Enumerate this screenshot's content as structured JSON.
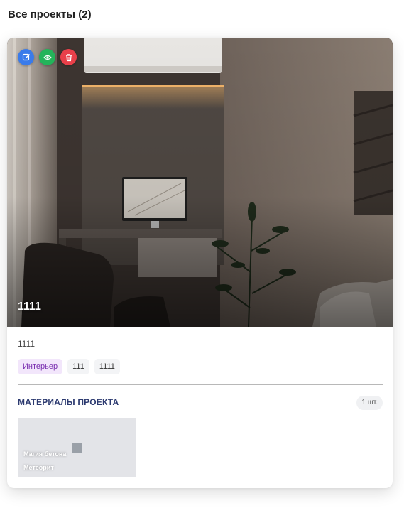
{
  "header": {
    "title": "Все проекты (2)"
  },
  "project": {
    "cover_title": "1111",
    "description": "1111",
    "actions": [
      {
        "name": "edit",
        "icon": "pencil-icon",
        "color": "#3a7bea"
      },
      {
        "name": "view",
        "icon": "eye-icon",
        "color": "#23b45a"
      },
      {
        "name": "delete",
        "icon": "trash-icon",
        "color": "#e8404a"
      }
    ],
    "tags": [
      "Интерьер",
      "111",
      "1111"
    ],
    "materials": {
      "title": "МАТЕРИАЛЫ ПРОЕКТА",
      "count": "1 шт.",
      "items": [
        {
          "name": "Магия бетона",
          "subname": "Метеорит"
        }
      ]
    }
  },
  "colors": {
    "accent_tag_bg": "#f2e6fb",
    "accent_tag_text": "#7a2fb0",
    "section_title": "#2c3a70"
  }
}
